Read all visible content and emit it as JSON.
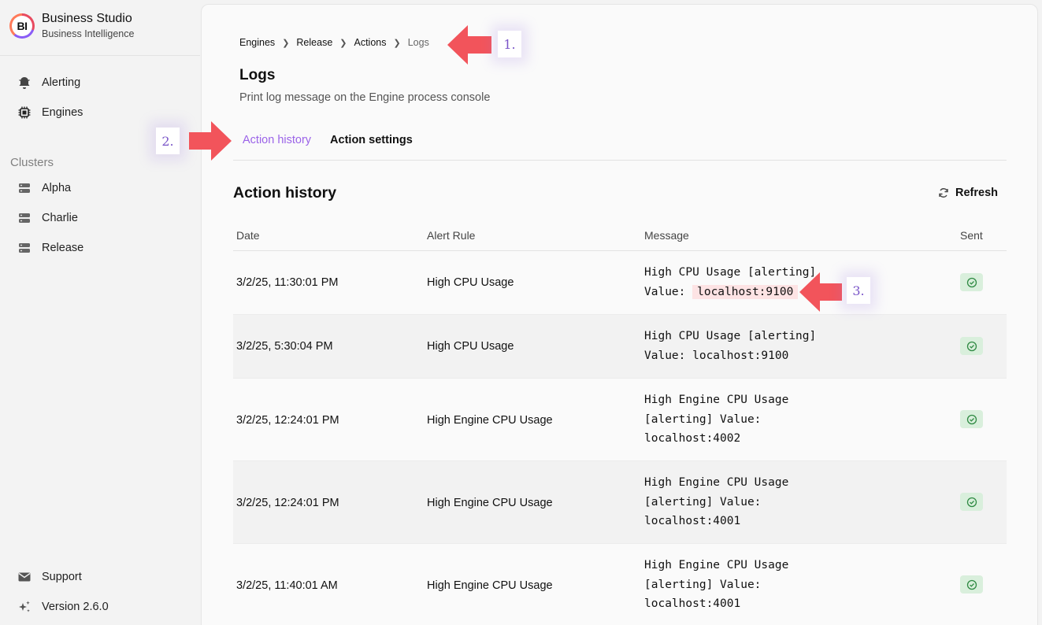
{
  "brand": {
    "logo_text": "BI",
    "name": "Business Studio",
    "subtitle": "Business Intelligence"
  },
  "sidebar": {
    "nav": [
      {
        "label": "Alerting",
        "icon": "bell-icon"
      },
      {
        "label": "Engines",
        "icon": "chip-icon"
      }
    ],
    "clusters_label": "Clusters",
    "clusters": [
      {
        "label": "Alpha",
        "icon": "server-icon"
      },
      {
        "label": "Charlie",
        "icon": "server-icon"
      },
      {
        "label": "Release",
        "icon": "server-icon"
      }
    ],
    "footer": [
      {
        "label": "Support",
        "icon": "mail-icon"
      },
      {
        "label": "Version 2.6.0",
        "icon": "sparkle-icon"
      }
    ]
  },
  "breadcrumb": [
    "Engines",
    "Release",
    "Actions",
    "Logs"
  ],
  "page": {
    "title": "Logs",
    "subtitle": "Print log message on the Engine process console"
  },
  "tabs": [
    {
      "label": "Action history",
      "active": true
    },
    {
      "label": "Action settings",
      "active": false
    }
  ],
  "history": {
    "title": "Action history",
    "refresh_label": "Refresh",
    "columns": [
      "Date",
      "Alert Rule",
      "Message",
      "Sent"
    ],
    "rows": [
      {
        "date": "3/2/25, 11:30:01 PM",
        "rule": "High CPU Usage",
        "msg_lines": [
          "High CPU Usage [alerting]"
        ],
        "value_prefix": "Value: ",
        "value": "localhost:9100",
        "highlight": true
      },
      {
        "date": "3/2/25, 5:30:04 PM",
        "rule": "High CPU Usage",
        "msg_lines": [
          "High CPU Usage [alerting]",
          "Value: localhost:9100"
        ]
      },
      {
        "date": "3/2/25, 12:24:01 PM",
        "rule": "High Engine CPU Usage",
        "msg_lines": [
          "High Engine CPU Usage",
          "[alerting] Value:",
          "localhost:4002"
        ]
      },
      {
        "date": "3/2/25, 12:24:01 PM",
        "rule": "High Engine CPU Usage",
        "msg_lines": [
          "High Engine CPU Usage",
          "[alerting] Value:",
          "localhost:4001"
        ]
      },
      {
        "date": "3/2/25, 11:40:01 AM",
        "rule": "High Engine CPU Usage",
        "msg_lines": [
          "High Engine CPU Usage",
          "[alerting] Value:",
          "localhost:4001"
        ]
      }
    ]
  },
  "annotations": [
    "1.",
    "2.",
    "3."
  ],
  "colors": {
    "accent": "#9b63e8",
    "arrow": "#f2545b",
    "sent_bg": "#d9efdc",
    "sent_icon": "#2f8a43",
    "highlight": "#fde3e4"
  }
}
